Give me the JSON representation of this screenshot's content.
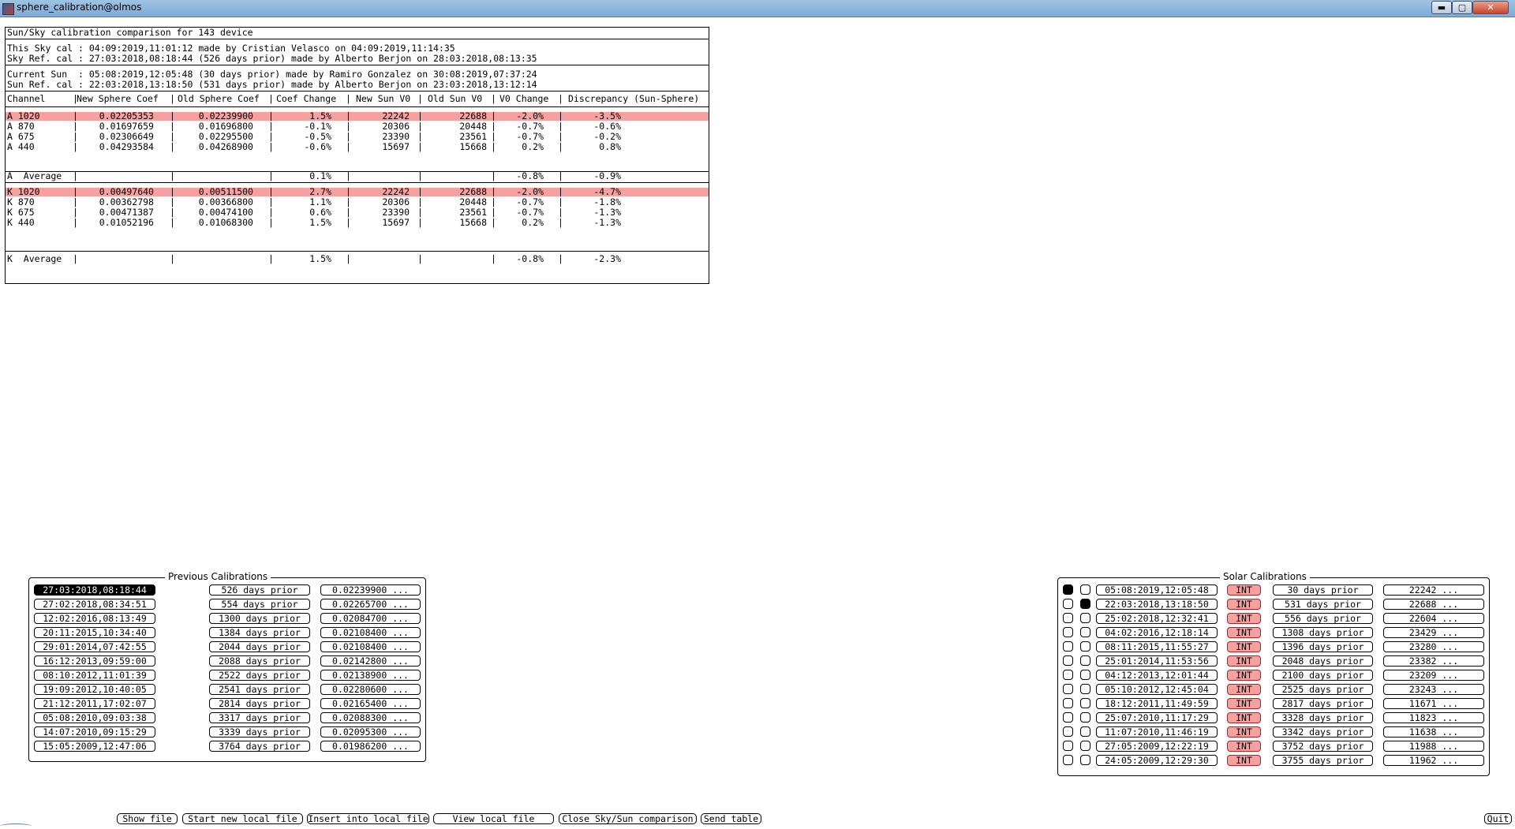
{
  "window": {
    "title": "sphere_calibration@olmos",
    "icons": {
      "app": "app-icon",
      "minimize": "minimize-icon",
      "maximize": "maximize-icon",
      "close": "close-icon"
    },
    "min_label": "▬",
    "max_label": "▢",
    "close_label": "✕"
  },
  "report": {
    "heading": "Sun/Sky calibration comparison for 143 device",
    "sky_lines": [
      "This Sky cal : 04:09:2019,11:01:12 made by Cristian Velasco on 04:09:2019,11:14:35",
      "Sky Ref. cal : 27:03:2018,08:18:44 (526 days prior) made by Alberto Berjon on 28:03:2018,08:13:35"
    ],
    "sun_lines": [
      "Current Sun  : 05:08:2019,12:05:48 (30 days prior) made by Ramiro Gonzalez on 30:08:2019,07:37:24",
      "Sun Ref. cal : 22:03:2018,13:18:50 (531 days prior) made by Alberto Berjon on 23:03:2018,13:12:14"
    ],
    "columns": [
      "Channel",
      "New Sphere Coef",
      "Old Sphere Coef",
      "Coef Change",
      "New Sun V0",
      "Old Sun V0",
      "V0 Change",
      "Discrepancy (Sun-Sphere)"
    ],
    "separator": "|",
    "group_a": {
      "rows": [
        {
          "channel": "A 1020",
          "new_coef": "0.02205353",
          "old_coef": "0.02239900",
          "coef_change": "1.5%",
          "new_v0": "22242",
          "old_v0": "22688",
          "v0_change": "-2.0%",
          "discrepancy": "-3.5%",
          "highlight": true
        },
        {
          "channel": "A 870",
          "new_coef": "0.01697659",
          "old_coef": "0.01696800",
          "coef_change": "-0.1%",
          "new_v0": "20306",
          "old_v0": "20448",
          "v0_change": "-0.7%",
          "discrepancy": "-0.6%",
          "highlight": false
        },
        {
          "channel": "A 675",
          "new_coef": "0.02306649",
          "old_coef": "0.02295500",
          "coef_change": "-0.5%",
          "new_v0": "23390",
          "old_v0": "23561",
          "v0_change": "-0.7%",
          "discrepancy": "-0.2%",
          "highlight": false
        },
        {
          "channel": "A 440",
          "new_coef": "0.04293584",
          "old_coef": "0.04268900",
          "coef_change": "-0.6%",
          "new_v0": "15697",
          "old_v0": "15668",
          "v0_change": "0.2%",
          "discrepancy": "0.8%",
          "highlight": false
        }
      ],
      "average": {
        "channel": "A  Average",
        "coef_change": "0.1%",
        "v0_change": "-0.8%",
        "discrepancy": "-0.9%"
      }
    },
    "group_k": {
      "rows": [
        {
          "channel": "K 1020",
          "new_coef": "0.00497640",
          "old_coef": "0.00511500",
          "coef_change": "2.7%",
          "new_v0": "22242",
          "old_v0": "22688",
          "v0_change": "-2.0%",
          "discrepancy": "-4.7%",
          "highlight": true
        },
        {
          "channel": "K 870",
          "new_coef": "0.00362798",
          "old_coef": "0.00366800",
          "coef_change": "1.1%",
          "new_v0": "20306",
          "old_v0": "20448",
          "v0_change": "-0.7%",
          "discrepancy": "-1.8%",
          "highlight": false
        },
        {
          "channel": "K 675",
          "new_coef": "0.00471387",
          "old_coef": "0.00474100",
          "coef_change": "0.6%",
          "new_v0": "23390",
          "old_v0": "23561",
          "v0_change": "-0.7%",
          "discrepancy": "-1.3%",
          "highlight": false
        },
        {
          "channel": "K 440",
          "new_coef": "0.01052196",
          "old_coef": "0.01068300",
          "coef_change": "1.5%",
          "new_v0": "15697",
          "old_v0": "15668",
          "v0_change": "0.2%",
          "discrepancy": "-1.3%",
          "highlight": false
        }
      ],
      "average": {
        "channel": "K  Average",
        "coef_change": "1.5%",
        "v0_change": "-0.8%",
        "discrepancy": "-2.3%"
      }
    }
  },
  "previous_calibrations": {
    "title": "Previous Calibrations",
    "items": [
      {
        "date": "27:03:2018,08:18:44",
        "prior": "526 days prior",
        "coef": "0.02239900 ...",
        "selected": true
      },
      {
        "date": "27:02:2018,08:34:51",
        "prior": "554 days prior",
        "coef": "0.02265700 ...",
        "selected": false
      },
      {
        "date": "12:02:2016,08:13:49",
        "prior": "1300 days prior",
        "coef": "0.02084700 ...",
        "selected": false
      },
      {
        "date": "20:11:2015,10:34:40",
        "prior": "1384 days prior",
        "coef": "0.02108400 ...",
        "selected": false
      },
      {
        "date": "29:01:2014,07:42:55",
        "prior": "2044 days prior",
        "coef": "0.02108400 ...",
        "selected": false
      },
      {
        "date": "16:12:2013,09:59:00",
        "prior": "2088 days prior",
        "coef": "0.02142800 ...",
        "selected": false
      },
      {
        "date": "08:10:2012,11:01:39",
        "prior": "2522 days prior",
        "coef": "0.02138900 ...",
        "selected": false
      },
      {
        "date": "19:09:2012,10:40:05",
        "prior": "2541 days prior",
        "coef": "0.02280600 ...",
        "selected": false
      },
      {
        "date": "21:12:2011,17:02:07",
        "prior": "2814 days prior",
        "coef": "0.02165400 ...",
        "selected": false
      },
      {
        "date": "05:08:2010,09:03:38",
        "prior": "3317 days prior",
        "coef": "0.02088300 ...",
        "selected": false
      },
      {
        "date": "14:07:2010,09:15:29",
        "prior": "3339 days prior",
        "coef": "0.02095300 ...",
        "selected": false
      },
      {
        "date": "15:05:2009,12:47:06",
        "prior": "3764 days prior",
        "coef": "0.01986200 ...",
        "selected": false
      }
    ]
  },
  "solar_calibrations": {
    "title": "Solar Calibrations",
    "items": [
      {
        "date": "05:08:2019,12:05:48",
        "type": "INT",
        "prior": "30 days prior",
        "v0": "22242 ...",
        "radio1": true,
        "radio2": false
      },
      {
        "date": "22:03:2018,13:18:50",
        "type": "INT",
        "prior": "531 days prior",
        "v0": "22688 ...",
        "radio1": false,
        "radio2": true
      },
      {
        "date": "25:02:2018,12:32:41",
        "type": "INT",
        "prior": "556 days prior",
        "v0": "22604 ...",
        "radio1": false,
        "radio2": false
      },
      {
        "date": "04:02:2016,12:18:14",
        "type": "INT",
        "prior": "1308 days prior",
        "v0": "23429 ...",
        "radio1": false,
        "radio2": false
      },
      {
        "date": "08:11:2015,11:55:27",
        "type": "INT",
        "prior": "1396 days prior",
        "v0": "23280 ...",
        "radio1": false,
        "radio2": false
      },
      {
        "date": "25:01:2014,11:53:56",
        "type": "INT",
        "prior": "2048 days prior",
        "v0": "23382 ...",
        "radio1": false,
        "radio2": false
      },
      {
        "date": "04:12:2013,12:01:44",
        "type": "INT",
        "prior": "2100 days prior",
        "v0": "23209 ...",
        "radio1": false,
        "radio2": false
      },
      {
        "date": "05:10:2012,12:45:04",
        "type": "INT",
        "prior": "2525 days prior",
        "v0": "23243 ...",
        "radio1": false,
        "radio2": false
      },
      {
        "date": "18:12:2011,11:49:59",
        "type": "INT",
        "prior": "2817 days prior",
        "v0": "11671 ...",
        "radio1": false,
        "radio2": false
      },
      {
        "date": "25:07:2010,11:17:29",
        "type": "INT",
        "prior": "3328 days prior",
        "v0": "11823 ...",
        "radio1": false,
        "radio2": false
      },
      {
        "date": "11:07:2010,11:46:19",
        "type": "INT",
        "prior": "3342 days prior",
        "v0": "11638 ...",
        "radio1": false,
        "radio2": false
      },
      {
        "date": "27:05:2009,12:22:19",
        "type": "INT",
        "prior": "3752 days prior",
        "v0": "11988 ...",
        "radio1": false,
        "radio2": false
      },
      {
        "date": "24:05:2009,12:29:30",
        "type": "INT",
        "prior": "3755 days prior",
        "v0": "11962 ...",
        "radio1": false,
        "radio2": false
      }
    ]
  },
  "bottom_buttons": {
    "show_file": "Show file",
    "start_new_local_file": "Start new local file",
    "insert_into_local_file": "Insert into local file",
    "view_local_file": "View local file",
    "close_comparison": "Close Sky/Sun comparison",
    "send_table": "Send table",
    "quit": "Quit"
  },
  "colors": {
    "highlight": "#f7a0a0",
    "selected": "#000000",
    "titlebar": "#8bb4dc"
  }
}
